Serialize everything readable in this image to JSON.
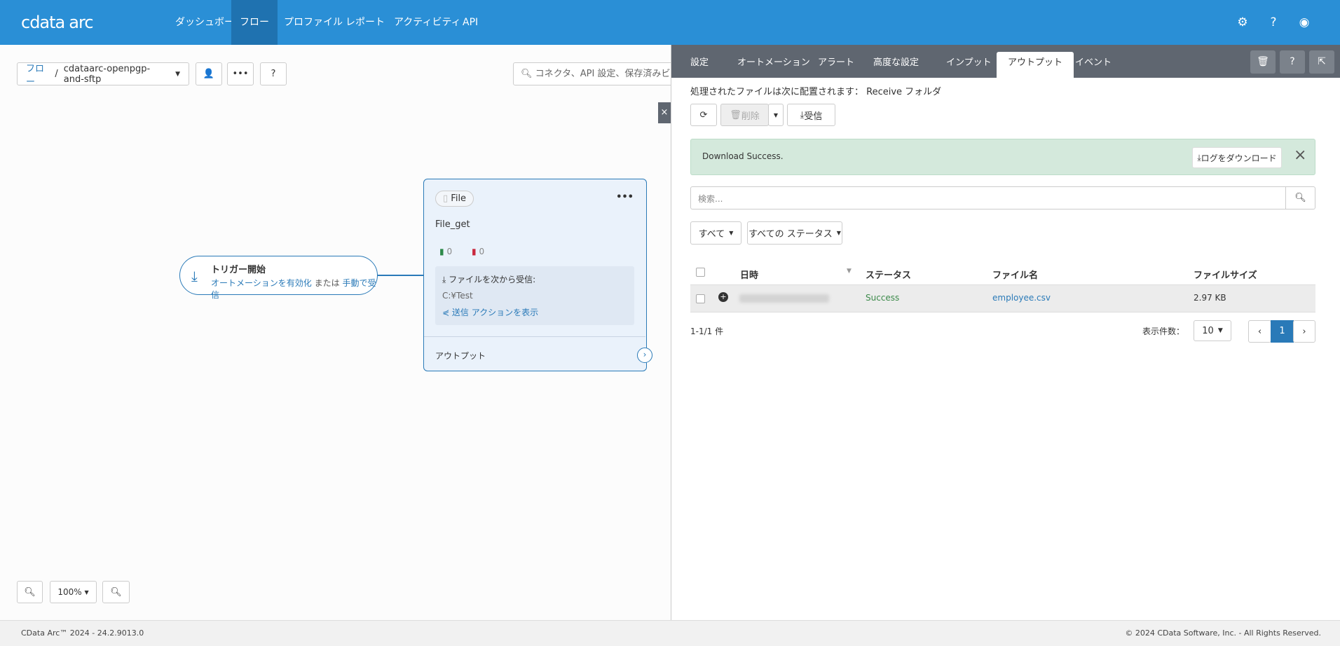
{
  "header": {
    "logo_main": "cdata",
    "logo_sub": "arc",
    "nav": [
      "ダッシュボード",
      "フロー",
      "プロファイル",
      "レポート",
      "アクティビティ",
      "API"
    ]
  },
  "toolbar": {
    "breadcrumb_root": "フロー",
    "breadcrumb_sep": "/",
    "flow_name": "cdataarc-openpgp-and-sftp",
    "search_placeholder": "コネクタ、API 設定、保存済みビュー、.."
  },
  "canvas": {
    "trigger": {
      "title": "トリガー開始",
      "link1": "オートメーションを有効化",
      "or": "または",
      "link2": "手動で受信"
    },
    "node": {
      "type": "File",
      "name": "File_get",
      "success_count": "0",
      "error_count": "0",
      "receive_label": "ファイルを次から受信:",
      "path": "C:¥Test",
      "send_action": "送信 アクションを表示",
      "output": "アウトプット"
    },
    "zoom": "100%"
  },
  "panel": {
    "tabs": [
      "設定",
      "オートメーション",
      "アラート",
      "高度な設定",
      "インプット",
      "アウトプット",
      "イベント"
    ],
    "active_tab": "アウトプット",
    "location_label": "処理されたファイルは次に配置されます：",
    "location_value": "Receive フォルダ",
    "delete_label": "削除",
    "receive_label": "受信",
    "alert_text": "Download Success.",
    "download_log": "ログをダウンロード",
    "search_placeholder": "検索...",
    "filter_all": "すべて",
    "filter_status": "すべての ステータス",
    "columns": [
      "日時",
      "ステータス",
      "ファイル名",
      "ファイルサイズ"
    ],
    "rows": [
      {
        "status": "Success",
        "file": "employee.csv",
        "size": "2.97 KB"
      }
    ],
    "count": "1-1/1 件",
    "per_page_label": "表示件数：",
    "per_page": "10",
    "page": "1"
  },
  "footer": {
    "version": "CData Arc™ 2024 - 24.2.9013.0",
    "copyright": "© 2024 CData Software, Inc. - All Rights Reserved."
  },
  "colors": {
    "brand": "#2a8fd6",
    "success": "#3c8a4a",
    "link": "#2a7ab8"
  }
}
